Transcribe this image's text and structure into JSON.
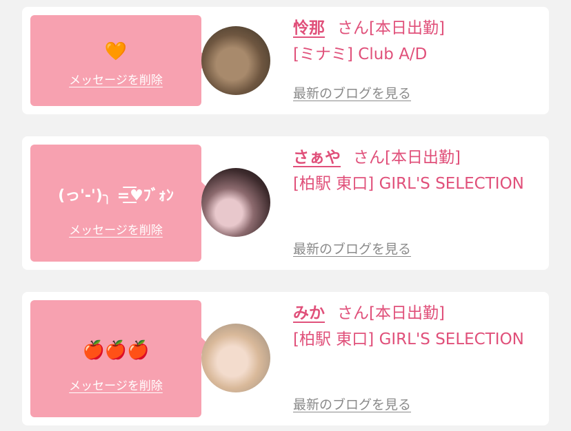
{
  "cards": [
    {
      "message": "🧡",
      "delete_label": "メッセージを削除",
      "name": "怜那",
      "status": "さん[本日出勤]",
      "shop": "[ミナミ] Club A/D",
      "blog_link": "最新のブログを見る"
    },
    {
      "message": "(っ'-')╮ =͟͟͞♥ﾌﾞｫﾝ",
      "delete_label": "メッセージを削除",
      "name": "さぁや",
      "status": "さん[本日出勤]",
      "shop": "[柏駅 東口] GIRL'S SELECTION",
      "blog_link": "最新のブログを見る"
    },
    {
      "message": "🍎🍎🍎",
      "delete_label": "メッセージを削除",
      "name": "みか",
      "status": "さん[本日出勤]",
      "shop": "[柏駅 東口] GIRL'S SELECTION",
      "blog_link": "最新のブログを見る"
    }
  ],
  "colors": {
    "bubble": "#f7a1b0",
    "accent": "#e0507a",
    "link_gray": "#8a8a8a",
    "background": "#f2f2f2"
  }
}
